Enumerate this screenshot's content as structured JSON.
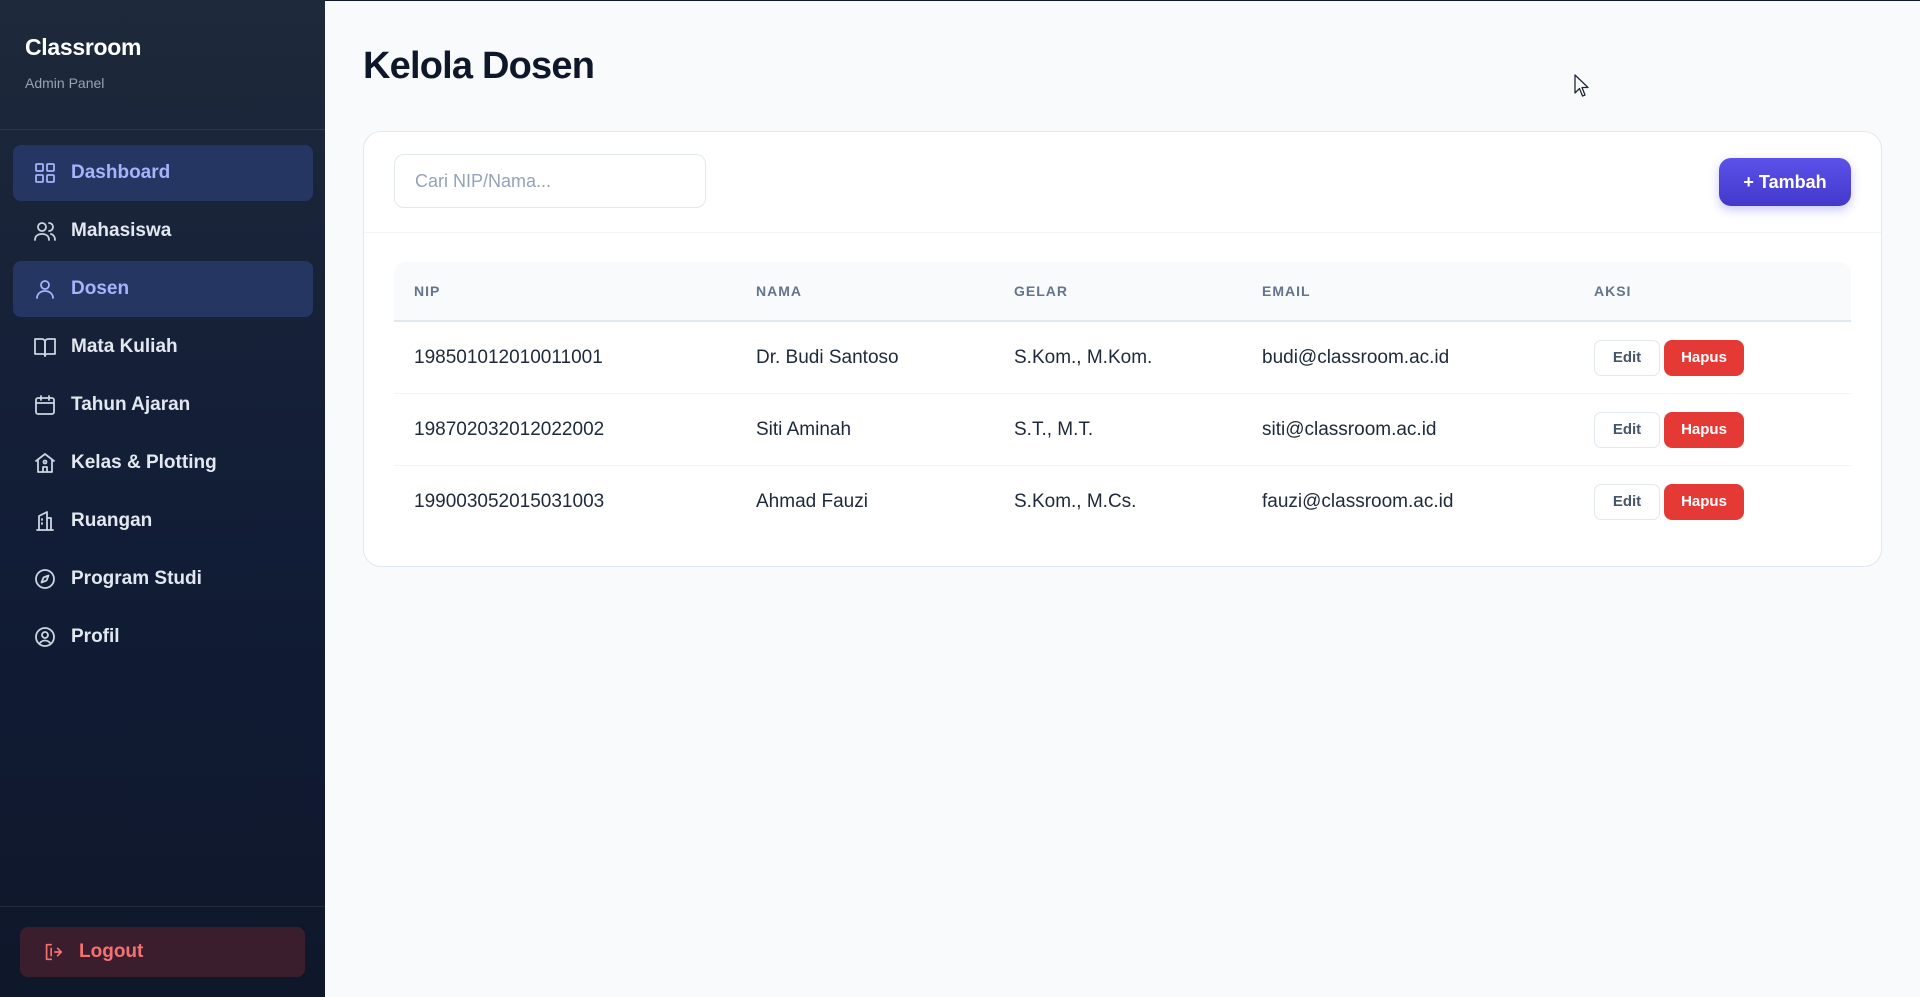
{
  "sidebar": {
    "brand_title": "Classroom",
    "brand_subtitle": "Admin Panel",
    "items": [
      {
        "label": "Dashboard",
        "icon": "grid-icon",
        "active": true
      },
      {
        "label": "Mahasiswa",
        "icon": "users-icon",
        "active": false
      },
      {
        "label": "Dosen",
        "icon": "user-icon",
        "active": true
      },
      {
        "label": "Mata Kuliah",
        "icon": "book-icon",
        "active": false
      },
      {
        "label": "Tahun Ajaran",
        "icon": "calendar-icon",
        "active": false
      },
      {
        "label": "Kelas & Plotting",
        "icon": "school-icon",
        "active": false
      },
      {
        "label": "Ruangan",
        "icon": "building-icon",
        "active": false
      },
      {
        "label": "Program Studi",
        "icon": "compass-icon",
        "active": false
      },
      {
        "label": "Profil",
        "icon": "user-circle-icon",
        "active": false
      }
    ],
    "logout_label": "Logout"
  },
  "main": {
    "title": "Kelola Dosen",
    "search": {
      "placeholder": "Cari NIP/Nama...",
      "value": ""
    },
    "add_button_label": "+ Tambah",
    "table": {
      "headers": [
        "NIP",
        "NAMA",
        "GELAR",
        "EMAIL",
        "AKSI"
      ],
      "rows": [
        {
          "nip": "198501012010011001",
          "nama": "Dr. Budi Santoso",
          "gelar": "S.Kom., M.Kom.",
          "email": "budi@classroom.ac.id"
        },
        {
          "nip": "198702032012022002",
          "nama": "Siti Aminah",
          "gelar": "S.T., M.T.",
          "email": "siti@classroom.ac.id"
        },
        {
          "nip": "199003052015031003",
          "nama": "Ahmad Fauzi",
          "gelar": "S.Kom., M.Cs.",
          "email": "fauzi@classroom.ac.id"
        }
      ],
      "edit_label": "Edit",
      "delete_label": "Hapus"
    }
  },
  "colors": {
    "sidebar_bg": "#1e293b",
    "active_item_bg": "#263663",
    "active_item_text": "#a5b4fc",
    "primary": "#4f46e5",
    "danger": "#e53935"
  }
}
